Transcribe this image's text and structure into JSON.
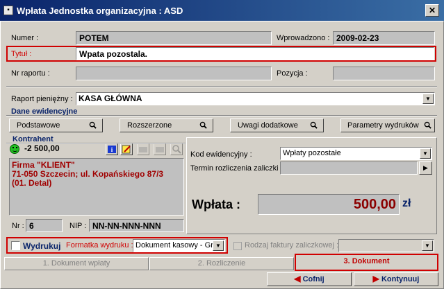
{
  "window": {
    "title": "Wpłata Jednostka organizacyjna : ASD",
    "close_label": "✕"
  },
  "form": {
    "numer_label": "Numer :",
    "numer_value": "POTEM",
    "wprowadzono_label": "Wprowadzono :",
    "wprowadzono_value": "2009-02-23",
    "tytul_label": "Tytuł :",
    "tytul_value": "Wpata pozostala.",
    "nr_raportu_label": "Nr raportu :",
    "nr_raportu_value": "",
    "pozycja_label": "Pozycja :",
    "pozycja_value": "",
    "raport_label": "Raport pieniężny :",
    "raport_value": "KASA GŁÓWNA"
  },
  "dane": {
    "title": "Dane ewidencyjne",
    "buttons": [
      "Podstawowe",
      "Rozszerzone",
      "Uwagi dodatkowe",
      "Parametry wydruków"
    ]
  },
  "kontrahent": {
    "title": "Kontrahent",
    "balance": "-2 500,00",
    "lines": [
      "Firma \"KLIENT\"",
      "71-050 Szczecin; ul. Kopańskiego 87/3",
      "(01. Detal)"
    ],
    "nr_label": "Nr :",
    "nr_value": "6",
    "nip_label": "NIP :",
    "nip_value": "NN-NN-NNN-NNN"
  },
  "right": {
    "kod_label": "Kod ewidencyjny :",
    "kod_value": "Wpłaty pozostałe",
    "termin_label": "Termin rozliczenia zaliczki :",
    "wplata_label": "Wpłata :",
    "wplata_value": "500,00",
    "currency": "zł"
  },
  "bottom": {
    "wydrukuj_label": "Wydrukuj",
    "formatka_label": "Formatka wydruku :",
    "formatka_value": "Dokument kasowy - Gra",
    "rodzaj_label": "Rodzaj faktury zaliczkowej :"
  },
  "tabs": [
    "1. Dokument wpłaty",
    "2. Rozliczenie",
    "3. Dokument"
  ],
  "nav": {
    "back_label": "Cofnij",
    "next_label": "Kontynuuj"
  },
  "colors": {
    "accent_red": "#d00000",
    "title_blue": "#0a246a",
    "amount_red": "#8b0000"
  }
}
